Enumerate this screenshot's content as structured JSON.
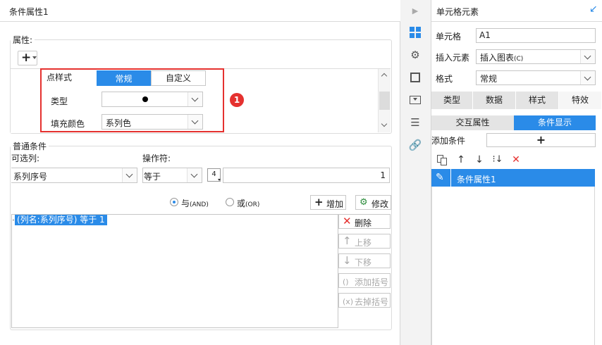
{
  "dialog": {
    "title": "条件属性1",
    "attr_group_label": "属性:",
    "attr_rows": {
      "point_style_label": "点样式",
      "segment_normal": "常规",
      "segment_custom": "自定义",
      "type_label": "类型",
      "fill_color_label": "填充颜色",
      "fill_color_value": "系列色"
    },
    "callout_badge": "1",
    "cond_group_label": "普通条件",
    "optional_col_label": "可选列:",
    "operator_label": "操作符:",
    "column_value": "系列序号",
    "operator_value": "等于",
    "value_type_icon_text": "4",
    "value": "1",
    "radio_and_main": "与",
    "radio_and_sub": "(AND)",
    "radio_or_main": "或",
    "radio_or_sub": "(OR)",
    "add_btn": "增加",
    "modify_btn": "修改",
    "condition_item": "(列名:系列序号) 等于 1",
    "delete_btn": "删除",
    "moveup_btn": "上移",
    "movedown_btn": "下移",
    "add_bracket_btn": "添加括号",
    "remove_bracket_btn": "去掉括号"
  },
  "panel": {
    "title": "单元格元素",
    "cell_label": "单元格",
    "cell_value": "A1",
    "insert_label": "插入元素",
    "insert_value_main": "插入图表",
    "insert_value_sub": "(C)",
    "format_label": "格式",
    "format_value": "常规",
    "tabs": [
      "类型",
      "数据",
      "样式",
      "特效"
    ],
    "active_tab": "特效",
    "sub_tab_interact": "交互属性",
    "sub_tab_cond": "条件显示",
    "add_cond_label": "添加条件",
    "cond_item": "条件属性1"
  },
  "colors": {
    "accent": "#2a8be8",
    "highlight": "#e5312f",
    "delete": "#e5312f"
  }
}
